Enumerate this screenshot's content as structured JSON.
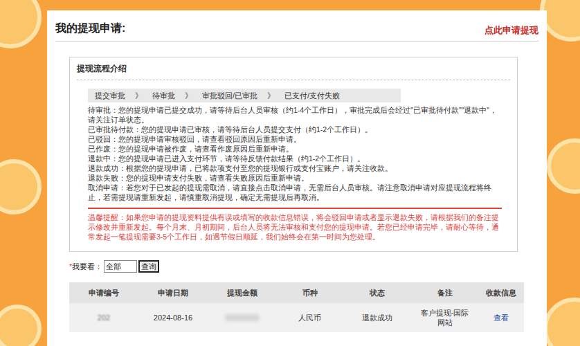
{
  "page": {
    "title": "我的提现申请:",
    "apply_link": "点此申请提现"
  },
  "intro": {
    "title": "提现流程介绍",
    "steps": [
      "提交审批",
      "待审批",
      "审批驳回/已审批",
      "已支付/支付失败"
    ],
    "separator": "》",
    "descriptions": [
      "待审批：您的提现申请已提交成功，请等待后台人员审核（约1-4个工作日），审批完成后会经过\"已审批待付款\"\"退款中\"，请关注订单状态。",
      "已审批待付款：您的提现申请已审核，请等待后台人员提交支付（约1-2个工作日）。",
      "已驳回：您的提现申请审核驳回，请查看驳回原因后重新申请。",
      "已作废：您的提现申请被作废，请查看作废原因后重新申请。",
      "退款中：您的提现申请已进入支付环节，请等待反馈付款结果（约1-2个工作日）。",
      "退款成功：根据您的提现申请，已将款项支付至您的提现银行或支付宝账户，请关注收款。",
      "退款失败：您的提现申请支付失败，请查看失败原因后重新申请。",
      "取消申请：若您对于已发起的提现需取消，请直接点击取消申请，无需后台人员审核。请注意取消申请对应提现流程将终止，若需提现请重新发起，请慎重取消提现，确定无需提现后再取消。"
    ],
    "notice": "温馨提醒：如果您申请的提现资料提供有误或填写的收款信息错误，将会驳回申请或者显示退款失败，请根据我们的备注提示修改并重新发起。每个月末、月初期间，后台人员将无法审核和支付您的提现申请。若您已经申请完毕，请耐心等待，通常发起一笔提现需要3-5个工作日，如遇节假日顺延，我们始终会在第一时间为您处理。"
  },
  "filter": {
    "required_mark": "*",
    "label": "我要看：",
    "value": "全部",
    "button": "查询"
  },
  "table": {
    "columns": [
      "申请编号",
      "申请日期",
      "提现金额",
      "币种",
      "状态",
      "备注",
      "收款信息"
    ],
    "rows": [
      {
        "id": "202",
        "id_blurred": true,
        "date": "2024-08-16",
        "amount_blurred": true,
        "currency": "人民币",
        "status": "退款成功",
        "remark": "客户提现-国际网站",
        "action": "查看"
      }
    ]
  }
}
